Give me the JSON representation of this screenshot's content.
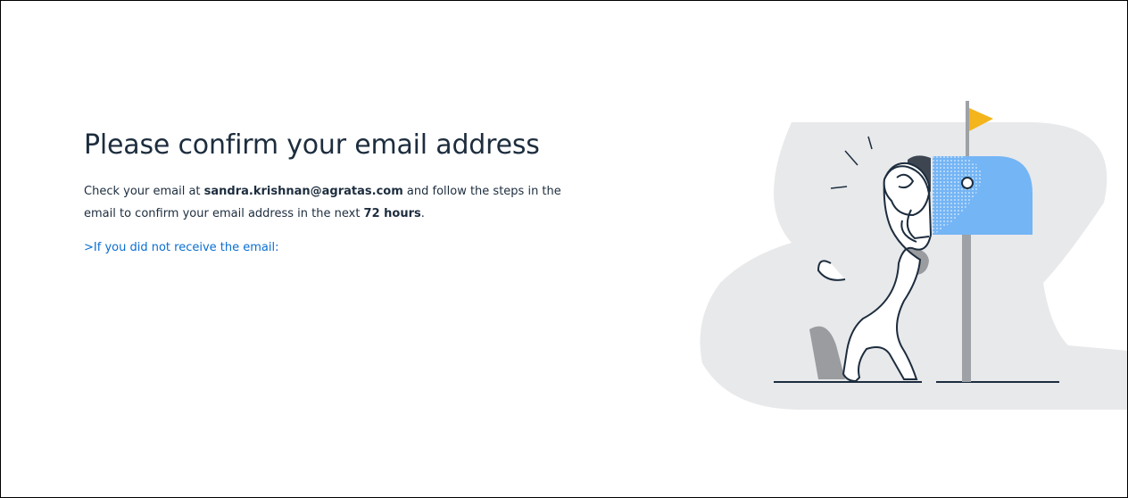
{
  "page": {
    "title": "Please confirm your email address",
    "message_prefix": "Check your email at ",
    "email": "sandra.krishnan@agratas.com",
    "message_middle": " and follow the steps in the email to confirm your email address in the next ",
    "deadline": "72 hours",
    "message_suffix": ".",
    "help_link_prefix": ">",
    "help_link_label": "If you did not receive the email:"
  },
  "illustration": {
    "subject": "dog-peeking-into-mailbox",
    "colors": {
      "background_blob": "#e8e9eb",
      "mailbox": "#74b5f5",
      "flag": "#f3b41c",
      "post": "#9ea1a5",
      "outline": "#1d2d3e",
      "shadow": "#9a9c9f"
    }
  },
  "colors": {
    "title_text": "#1d2d3e",
    "link": "#0a6ed1",
    "border": "#000000"
  }
}
